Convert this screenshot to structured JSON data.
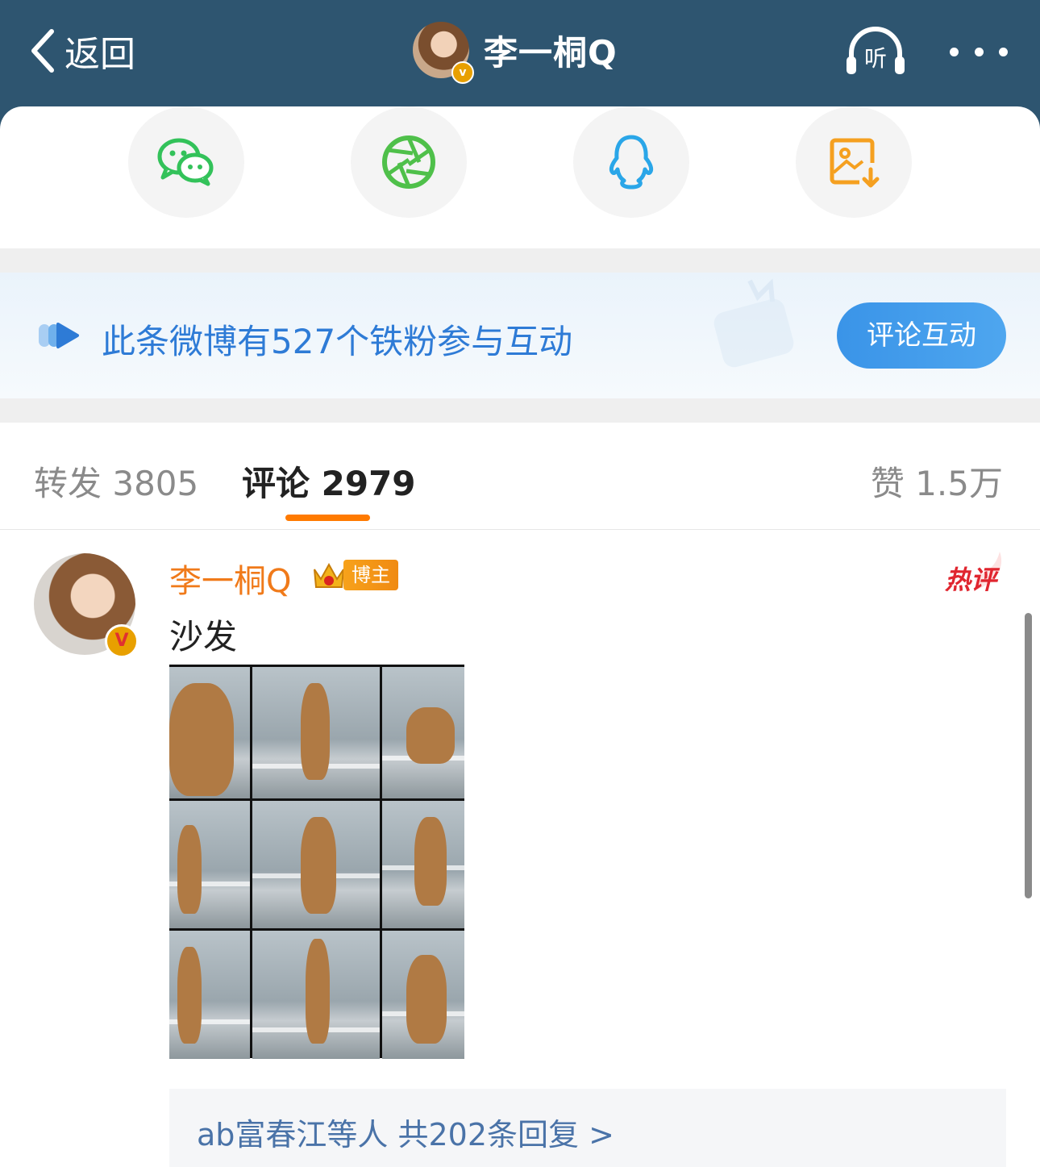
{
  "header": {
    "back_label": "返回",
    "title": "李一桐Q",
    "listen_label": "听"
  },
  "share": {
    "items": [
      "wechat",
      "moments",
      "qq",
      "save-image"
    ],
    "colors": {
      "wechat": "#33c25a",
      "moments": "#4fc04a",
      "qq": "#2aa6e8",
      "save": "#f5a020"
    }
  },
  "banner": {
    "text": "此条微博有527个铁粉参与互动",
    "button_label": "评论互动"
  },
  "tabs": {
    "repost": "转发 3805",
    "comment": "评论 2979",
    "like": "赞 1.5万",
    "active_color": "#ff7a00"
  },
  "comment": {
    "author": "李一桐Q",
    "badge_label": "博主",
    "hot_label": "热评",
    "text": "沙发",
    "replies_summary": "ab富春江等人  共202条回复 >"
  }
}
